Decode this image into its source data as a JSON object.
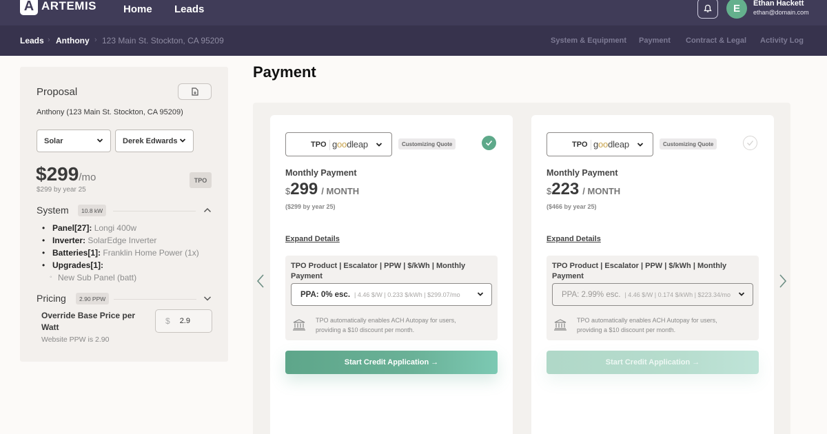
{
  "app": {
    "logo_letter": "A",
    "logo_text": "ARTEMIS",
    "nav": [
      {
        "label": "Home"
      },
      {
        "label": "Leads"
      }
    ],
    "user": {
      "initial": "E",
      "name": "Ethan Hackett",
      "email": "ethan@domain.com"
    }
  },
  "breadcrumb": {
    "items": [
      {
        "label": "Leads"
      },
      {
        "label": "Anthony"
      }
    ],
    "current": "123 Main St. Stockton, CA 95209",
    "separator": "›"
  },
  "tabs": [
    {
      "label": "System & Equipment"
    },
    {
      "label": "Payment"
    },
    {
      "label": "Contract & Legal"
    },
    {
      "label": "Activity Log"
    }
  ],
  "proposal": {
    "title": "Proposal",
    "address": "Anthony (123 Main St. Stockton, CA 95209)",
    "product_select": "Solar",
    "rep_select": "Derek Edwards",
    "price": "$299",
    "price_unit": "/mo",
    "price_sub": "$299 by year 25",
    "finance_badge": "TPO",
    "system": {
      "title": "System",
      "badge": "10.8 kW",
      "items": [
        {
          "label": "Panel[27]:",
          "value": "Longi 400w"
        },
        {
          "label": "Inverter:",
          "value": "SolarEdge Inverter"
        },
        {
          "label": "Batteries[1]:",
          "value": "Franklin Home Power (1x)"
        },
        {
          "label": "Upgrades[1]:",
          "value": ""
        }
      ],
      "sub_items": [
        "New Sub Panel (batt)"
      ]
    },
    "pricing": {
      "title": "Pricing",
      "badge": "2.90 PPW",
      "override_label": "Override Base Price per Watt",
      "website_ppw": "Website PPW is 2.90",
      "currency_symbol": "$",
      "override_value": "2.9"
    }
  },
  "payment": {
    "title": "Payment",
    "cards": [
      {
        "lender_type": "TPO",
        "lender_brand_pre": "g",
        "lender_brand_oo": "oo",
        "lender_brand_post": "dleap",
        "tag": "Customizing Quote",
        "selected": true,
        "monthly_label": "Monthly Payment",
        "currency": "$",
        "amount": "299",
        "per": "/ MONTH",
        "sub": "($299 by year 25)",
        "expand": "Expand Details",
        "details_header": "TPO Product | Escalator | PPW | $/kWh | Monthly Payment",
        "product_main": "PPA: 0% esc.",
        "product_meta": "| 4.46 $/W | 0.233 $/kWh | $299.07/mo",
        "ach_note": "TPO automatically enables ACH Autopay for users, providing a $10 discount per month.",
        "cta": "Start Credit Application →"
      },
      {
        "lender_type": "TPO",
        "lender_brand_pre": "g",
        "lender_brand_oo": "oo",
        "lender_brand_post": "dleap",
        "tag": "Customizing Quote",
        "selected": false,
        "monthly_label": "Monthly Payment",
        "currency": "$",
        "amount": "223",
        "per": "/ MONTH",
        "sub": "($466 by year 25)",
        "expand": "Expand Details",
        "details_header": "TPO Product | Escalator | PPW | $/kWh | Monthly Payment",
        "product_main": "PPA: 2.99% esc.",
        "product_meta": "| 4.46 $/W | 0.174 $/kWh | $223.34/mo",
        "ach_note": "TPO automatically enables ACH Autopay for users, providing a $10 discount per month.",
        "cta": "Start Credit Application →"
      }
    ]
  },
  "colors": {
    "nav_bg": "#403c58",
    "subnav_bg": "#37334d",
    "accent_green": "#5ea98a"
  }
}
